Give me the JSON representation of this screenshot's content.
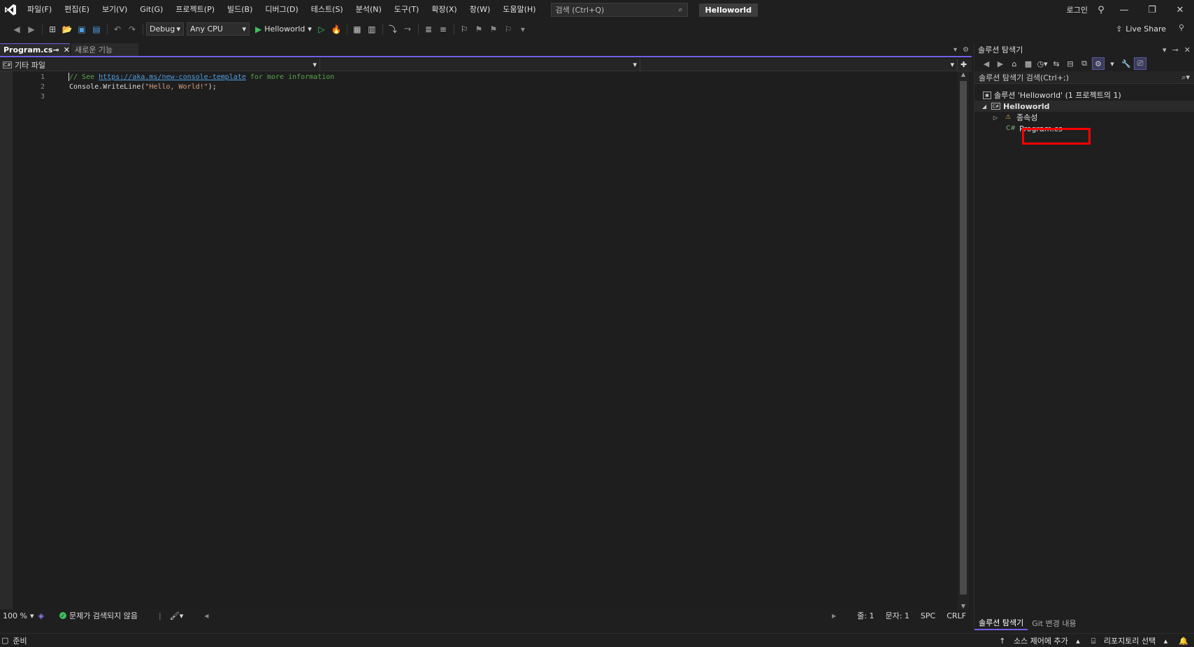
{
  "titlebar": {
    "menu": [
      "파일(F)",
      "편집(E)",
      "보기(V)",
      "Git(G)",
      "프로젝트(P)",
      "빌드(B)",
      "디버그(D)",
      "테스트(S)",
      "분석(N)",
      "도구(T)",
      "확장(X)",
      "창(W)",
      "도움말(H)"
    ],
    "search_placeholder": "검색 (Ctrl+Q)",
    "solution_name": "Helloworld",
    "login": "로그인"
  },
  "toolbar": {
    "config": "Debug",
    "platform": "Any CPU",
    "run_target": "Helloworld",
    "live_share": "Live Share"
  },
  "editor": {
    "tabs": [
      {
        "label": "Program.cs",
        "active": true
      },
      {
        "label": "새로운 기능",
        "active": false
      }
    ],
    "nav_context": "기타 파일",
    "lines": [
      {
        "no": "1",
        "comment_prefix": "// See ",
        "link": "https://aka.ms/new-console-template",
        "comment_suffix": " for more information"
      },
      {
        "no": "2",
        "code_prefix": "Console.WriteLine(",
        "string": "\"Hello, World!\"",
        "code_suffix": ");"
      },
      {
        "no": "3"
      }
    ],
    "status": {
      "zoom": "100 %",
      "issues": "문제가 검색되지 않음",
      "line": "줄: 1",
      "col": "문자: 1",
      "whitespace": "SPC",
      "line_ending": "CRLF"
    }
  },
  "solution_explorer": {
    "title": "솔루션 탐색기",
    "search": "솔루션 탐색기 검색(Ctrl+;)",
    "tree": {
      "solution": "솔루션 'Helloworld' (1 프로젝트의 1)",
      "project": "Helloworld",
      "dependencies": "종속성",
      "file": "Program.cs",
      "file_icon": "C#"
    },
    "bottom_tabs": [
      "솔루션 탐색기",
      "Git 변경 내용"
    ]
  },
  "statusbar": {
    "ready": "준비",
    "source_control": "소스 제어에 추가",
    "repository": "리포지토리 선택"
  }
}
